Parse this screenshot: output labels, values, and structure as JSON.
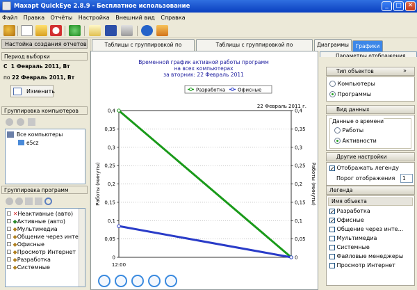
{
  "window": {
    "title": "Maxapt QuickEye 2.8.9 - Бесплатное использование",
    "min": "_",
    "max": "□",
    "close": "✕"
  },
  "menu": [
    "Файл",
    "Правка",
    "Отчёты",
    "Настройка",
    "Внешний вид",
    "Справка"
  ],
  "toolbar": {
    "icons": [
      "settings-icon",
      "new-report-icon",
      "lock-icon",
      "clock-icon",
      "refresh-icon",
      "copy-icon",
      "save-icon",
      "print-icon",
      "help-icon",
      "home-icon"
    ]
  },
  "left": {
    "settings_title": "Настойка создания отчетов",
    "period_title": "Период выборки",
    "from_label": "С",
    "from_date": "1 Февраль 2011, Вт",
    "to_label": "по",
    "to_date": "22 Февраль 2011, Вт",
    "change_button": "Изменить",
    "computer_group_title": "Группировка компьютеров",
    "computer_tree": [
      "Все компьютеры",
      "e5cz"
    ],
    "program_group_title": "Группировка программ",
    "program_tree": [
      "Неактивные (авто)",
      "Активные (авто)",
      "Мультимедиа",
      "Общение через инте",
      "Офисные",
      "Просмотр Интернет",
      "Разработка",
      "Системные"
    ]
  },
  "tabs": [
    "Таблицы с группировкой по времени",
    "Таблицы с группировкой по компьютерам",
    "Диаграммы",
    "Графики"
  ],
  "right": {
    "title": "Параметры отображения",
    "object_type_title": "Тип объектов",
    "object_types": [
      "Компьютеры",
      "Программы"
    ],
    "data_type_title": "Вид данных",
    "time_data_title": "Данные о времени",
    "time_types": [
      "Работы",
      "Активности"
    ],
    "other_title": "Другие настройки",
    "show_legend": "Отображать легенду",
    "threshold_label": "Порог отображения",
    "threshold_value": "1",
    "legend_title": "Легенда",
    "object_name_header": "Имя объекта",
    "legend_items": [
      {
        "label": "Разработка",
        "checked": true
      },
      {
        "label": "Офисные",
        "checked": true
      },
      {
        "label": "Общение через инте...",
        "checked": false
      },
      {
        "label": "Мультимедиа",
        "checked": false
      },
      {
        "label": "Системные",
        "checked": false
      },
      {
        "label": "Файловые менеджеры",
        "checked": false
      },
      {
        "label": "Просмотр Интернет",
        "checked": false
      }
    ]
  },
  "chart_data": {
    "type": "line",
    "title": "Временной график активной работы программ\nна всех компьютерах\nза вторник: 22 Февраль 2011",
    "title_lines": [
      "Временной график активной работы программ",
      "на всех компьютерах",
      "за вторник: 22 Февраль 2011"
    ],
    "date_label": "22 Февраль 2011 г.",
    "ylabel": "Работы (минуты)",
    "ylabel_right": "Работы (минуты)",
    "xlabel_tick": "12:00",
    "ylim": [
      0,
      0.4
    ],
    "yticks": [
      "0",
      "0,05",
      "0,1",
      "0,15",
      "0,2",
      "0,25",
      "0,3",
      "0,35",
      "0,4"
    ],
    "x": [
      "12:00",
      "end"
    ],
    "series": [
      {
        "name": "Разработка",
        "color": "#1a9a1a",
        "values": [
          0.4,
          0
        ]
      },
      {
        "name": "Офисные",
        "color": "#2a3cc8",
        "values": [
          0.085,
          0
        ]
      }
    ],
    "legend_position": "top",
    "grid": true
  }
}
